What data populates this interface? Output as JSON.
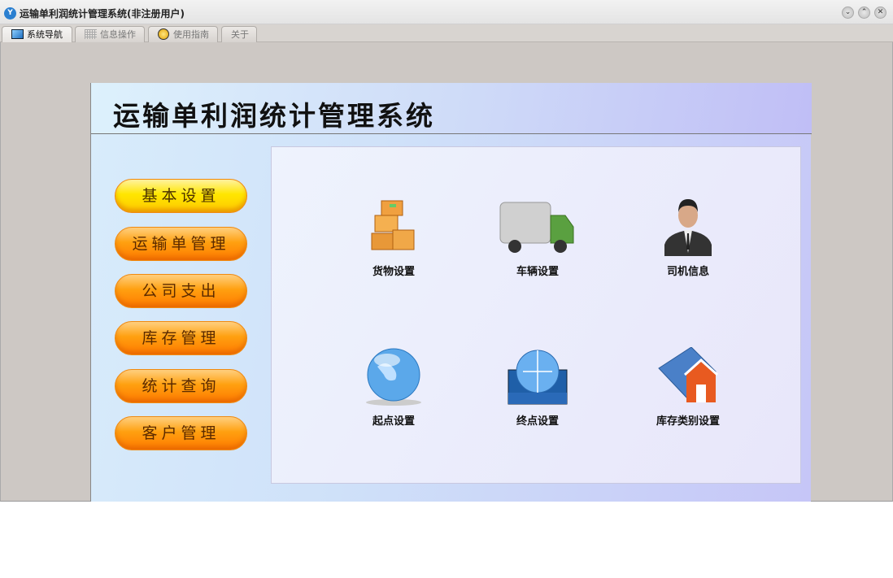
{
  "window": {
    "title": "运输单利润统计管理系统(非注册用户)",
    "icon": "app-logo-icon",
    "controls": [
      "minimize",
      "maximize",
      "close"
    ]
  },
  "tabs": [
    {
      "label": "系统导航",
      "icon": "monitor-icon",
      "active": true
    },
    {
      "label": "信息操作",
      "icon": "grid-icon"
    },
    {
      "label": "使用指南",
      "icon": "help-icon"
    },
    {
      "label": "关于"
    }
  ],
  "header": {
    "title": "运输单利润统计管理系统"
  },
  "nav": [
    "基本设置",
    "运输单管理",
    "公司支出",
    "库存管理",
    "统计查询",
    "客户管理"
  ],
  "items": [
    {
      "label": "货物设置",
      "icon": "boxes-icon"
    },
    {
      "label": "车辆设置",
      "icon": "truck-icon"
    },
    {
      "label": "司机信息",
      "icon": "driver-icon"
    },
    {
      "label": "起点设置",
      "icon": "globe-icon"
    },
    {
      "label": "终点设置",
      "icon": "destination-globe-icon"
    },
    {
      "label": "库存类别设置",
      "icon": "warehouse-icon"
    }
  ]
}
